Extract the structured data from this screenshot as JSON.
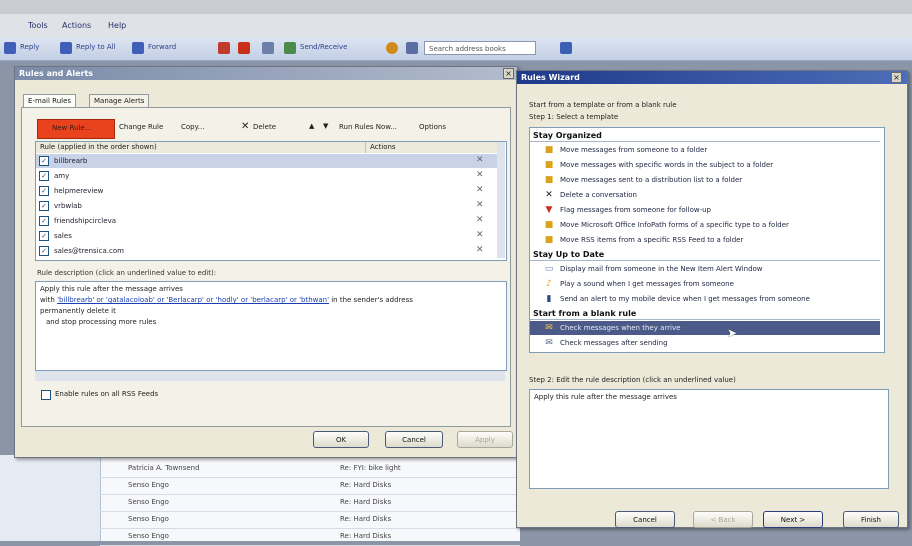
{
  "menu": {
    "tools": "Tools",
    "actions": "Actions",
    "help": "Help"
  },
  "toolbar": {
    "reply": "Reply",
    "reply_all": "Reply to All",
    "forward": "Forward",
    "send_receive": "Send/Receive",
    "search_placeholder": "Search address books"
  },
  "rules_dialog": {
    "title": "Rules and Alerts",
    "tabs": [
      "E-mail Rules",
      "Manage Alerts"
    ],
    "buttons": {
      "new_rule": "New Rule...",
      "change_rule": "Change Rule",
      "copy": "Copy...",
      "delete": "Delete",
      "run_rules": "Run Rules Now...",
      "options": "Options"
    },
    "columns": [
      "Rule (applied in the order shown)",
      "Actions"
    ],
    "rules": [
      {
        "name": "billbrearb"
      },
      {
        "name": "amy"
      },
      {
        "name": "helpmereview"
      },
      {
        "name": "vrbwlab"
      },
      {
        "name": "friendshipcircleva"
      },
      {
        "name": "sales"
      },
      {
        "name": "sales@trensica.com"
      }
    ],
    "description_label": "Rule description (click an underlined value to edit):",
    "description": {
      "line1": "Apply this rule after the message arrives",
      "line2_prefix": "with ",
      "line2_link": "'billbrearb' or 'gatalacoloab' or 'Berlacarp' or 'hodly' or 'berlacarp' or 'bthwan'",
      "line2_suffix": " in the sender's address",
      "line3": "permanently delete it",
      "line4": "and stop processing more rules"
    },
    "rss_label": "Enable rules on all RSS Feeds",
    "ok": "OK",
    "cancel": "Cancel",
    "apply": "Apply"
  },
  "wizard": {
    "title": "Rules Wizard",
    "intro": "Start from a template or from a blank rule",
    "step1": "Step 1: Select a template",
    "groups": [
      {
        "name": "Stay Organized",
        "items": [
          {
            "label": "Move messages from someone to a folder",
            "icon": "folder-icon"
          },
          {
            "label": "Move messages with specific words in the subject to a folder",
            "icon": "folder-icon"
          },
          {
            "label": "Move messages sent to a distribution list to a folder",
            "icon": "folder-icon"
          },
          {
            "label": "Delete a conversation",
            "icon": "delete-icon"
          },
          {
            "label": "Flag messages from someone for follow-up",
            "icon": "flag-icon"
          },
          {
            "label": "Move Microsoft Office InfoPath forms of a specific type to a folder",
            "icon": "folder-icon"
          },
          {
            "label": "Move RSS items from a specific RSS Feed to a folder",
            "icon": "folder-icon"
          }
        ]
      },
      {
        "name": "Stay Up to Date",
        "items": [
          {
            "label": "Display mail from someone in the New Item Alert Window",
            "icon": "alert-window-icon"
          },
          {
            "label": "Play a sound when I get messages from someone",
            "icon": "sound-icon"
          },
          {
            "label": "Send an alert to my mobile device when I get messages from someone",
            "icon": "mobile-icon"
          }
        ]
      },
      {
        "name": "Start from a blank rule",
        "items": [
          {
            "label": "Check messages when they arrive",
            "icon": "envelope-icon",
            "selected": true
          },
          {
            "label": "Check messages after sending",
            "icon": "outbox-icon"
          }
        ]
      }
    ],
    "step2": "Step 2: Edit the rule description (click an underlined value)",
    "step2_text": "Apply this rule after the message arrives",
    "cancel": "Cancel",
    "back": "< Back",
    "next": "Next >",
    "finish": "Finish"
  },
  "mail_list": [
    {
      "from": "Patricia A. Townsend",
      "subject": "Re: FYI: bike light"
    },
    {
      "from": "Senso Engo",
      "subject": "Re: Hard Disks"
    },
    {
      "from": "Senso Engo",
      "subject": "Re: Hard Disks"
    },
    {
      "from": "Senso Engo",
      "subject": "Re: Hard Disks"
    },
    {
      "from": "Senso Engo",
      "subject": "Re: Hard Disks"
    }
  ]
}
